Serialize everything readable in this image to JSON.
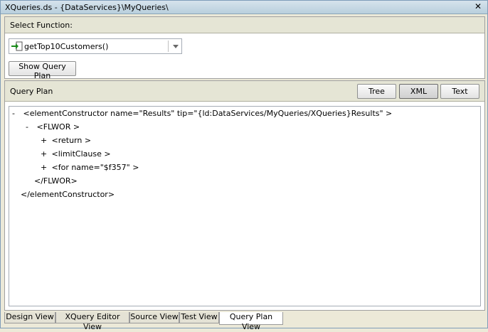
{
  "window": {
    "title": "XQueries.ds - {DataServices}\\MyQueries\\",
    "close_icon": "close-icon"
  },
  "select_function": {
    "label": "Select Function:",
    "value": "getTop10Customers()",
    "show_plan_label": "Show Query Plan"
  },
  "query_plan": {
    "label": "Query Plan",
    "view_buttons": [
      "Tree",
      "XML",
      "Text"
    ],
    "selected_view": "XML",
    "tree": [
      {
        "toggle": "-",
        "text": "<elementConstructor name=\"Results\" tip=\"{ld:DataServices/MyQueries/XQueries}Results\" >"
      },
      {
        "toggle": "-",
        "text": "<FLWOR >"
      },
      {
        "toggle": "+",
        "text": "<return >"
      },
      {
        "toggle": "+",
        "text": "<limitClause >"
      },
      {
        "toggle": "+",
        "text": "<for name=\"$f357\" >"
      },
      {
        "toggle": "",
        "text": "</FLWOR>"
      },
      {
        "toggle": "",
        "text": "</elementConstructor>"
      }
    ]
  },
  "tabs": [
    "Design View",
    "XQuery Editor View",
    "Source View",
    "Test View",
    "Query Plan View"
  ],
  "active_tab": "Query Plan View"
}
